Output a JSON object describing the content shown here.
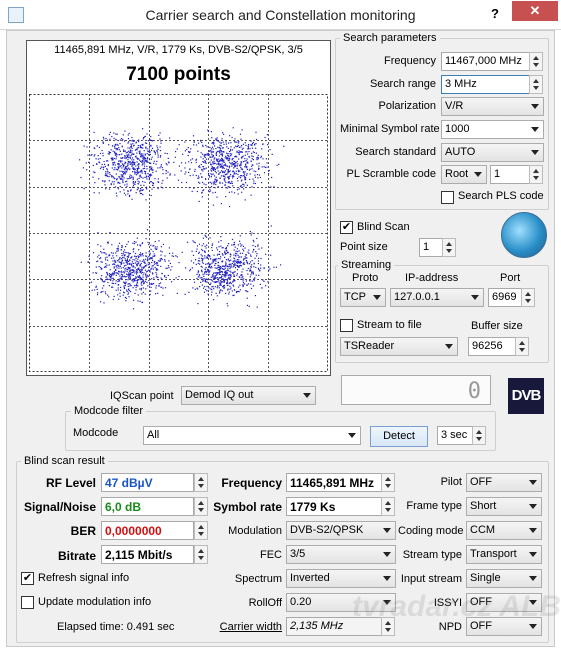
{
  "window": {
    "title": "Carrier search and Constellation monitoring",
    "help_label": "?",
    "close_label": "✕"
  },
  "plot": {
    "info": "11465,891 MHz, V/R, 1779 Ks, DVB-S2/QPSK, 3/5",
    "points": "7100 points",
    "point_color": "#2020c0"
  },
  "search_params": {
    "title": "Search parameters",
    "frequency_label": "Frequency",
    "frequency_value": "11467,000 MHz",
    "range_label": "Search range",
    "range_value": "3 MHz",
    "polarization_label": "Polarization",
    "polarization_value": "V/R",
    "min_sr_label": "Minimal Symbol rate",
    "min_sr_value": "1000",
    "standard_label": "Search standard",
    "standard_value": "AUTO",
    "pls_label": "PL Scramble code",
    "pls_mode": "Root",
    "pls_value": "1",
    "search_pls_label": "Search PLS code"
  },
  "blind_scan_label": "Blind Scan",
  "point_size_label": "Point size",
  "point_size_value": "1",
  "streaming": {
    "title": "Streaming",
    "proto_label": "Proto",
    "ip_label": "IP-address",
    "port_label": "Port",
    "proto_value": "TCP",
    "ip_value": "127.0.0.1",
    "port_value": "6969",
    "stream_to_file_label": "Stream to file",
    "buffer_label": "Buffer size",
    "reader_value": "TSReader",
    "buffer_value": "96256"
  },
  "iqscan": {
    "label": "IQScan point",
    "value": "Demod IQ out"
  },
  "lcd_value": "0",
  "dvb_logo": "DVB",
  "modcode": {
    "title": "Modcode filter",
    "label": "Modcode",
    "value": "All",
    "detect_label": "Detect",
    "interval_value": "3 sec"
  },
  "result": {
    "title": "Blind scan result",
    "rf_label": "RF Level",
    "rf_value": "47 dBµV",
    "sn_label": "Signal/Noise",
    "sn_value": "6,0 dB",
    "ber_label": "BER",
    "ber_value": "0,0000000",
    "bitrate_label": "Bitrate",
    "bitrate_value": "2,115 Mbit/s",
    "frequency_label": "Frequency",
    "frequency_value": "11465,891 MHz",
    "sr_label": "Symbol rate",
    "sr_value": "1779 Ks",
    "modulation_label": "Modulation",
    "modulation_value": "DVB-S2/QPSK",
    "fec_label": "FEC",
    "fec_value": "3/5",
    "spectrum_label": "Spectrum",
    "spectrum_value": "Inverted",
    "rolloff_label": "RollOff",
    "rolloff_value": "0.20",
    "carrier_width_label": "Carrier width",
    "carrier_width_value": "2,135 MHz",
    "pilot_label": "Pilot",
    "pilot_value": "OFF",
    "frame_label": "Frame type",
    "frame_value": "Short",
    "coding_label": "Coding mode",
    "coding_value": "CCM",
    "stream_type_label": "Stream type",
    "stream_type_value": "Transport",
    "input_stream_label": "Input stream",
    "input_stream_value": "Single",
    "issyi_label": "ISSYI",
    "issyi_value": "OFF",
    "npd_label": "NPD",
    "npd_value": "OFF",
    "refresh_label": "Refresh signal info",
    "update_label": "Update modulation info",
    "elapsed": "Elapsed time: 0.491 sec"
  },
  "check_mark": "✔",
  "watermark": "tvradar.cz ALBUM"
}
